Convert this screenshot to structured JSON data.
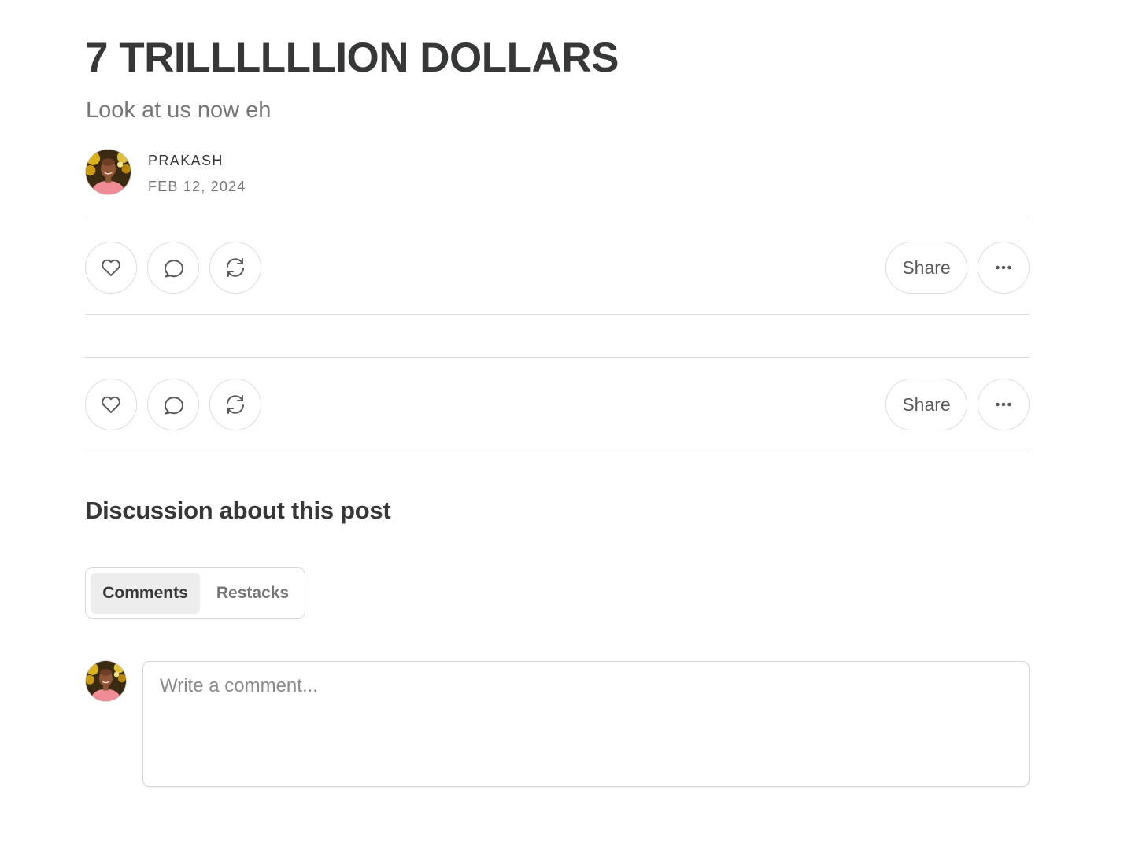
{
  "post": {
    "title": "7 TRILLLLLLION DOLLARS",
    "subtitle": "Look at us now eh",
    "author": "PRAKASH",
    "date": "FEB 12, 2024"
  },
  "actions": {
    "share_label": "Share",
    "icons": [
      "heart-icon",
      "comment-icon",
      "restack-icon",
      "more-icon"
    ]
  },
  "discussion": {
    "heading": "Discussion about this post",
    "tabs": [
      {
        "label": "Comments",
        "selected": true
      },
      {
        "label": "Restacks",
        "selected": false
      }
    ],
    "comment_placeholder": "Write a comment..."
  },
  "colors": {
    "text": "#363737",
    "muted": "#767676",
    "border": "#dcdcdc",
    "tab_active_bg": "#ededed"
  }
}
